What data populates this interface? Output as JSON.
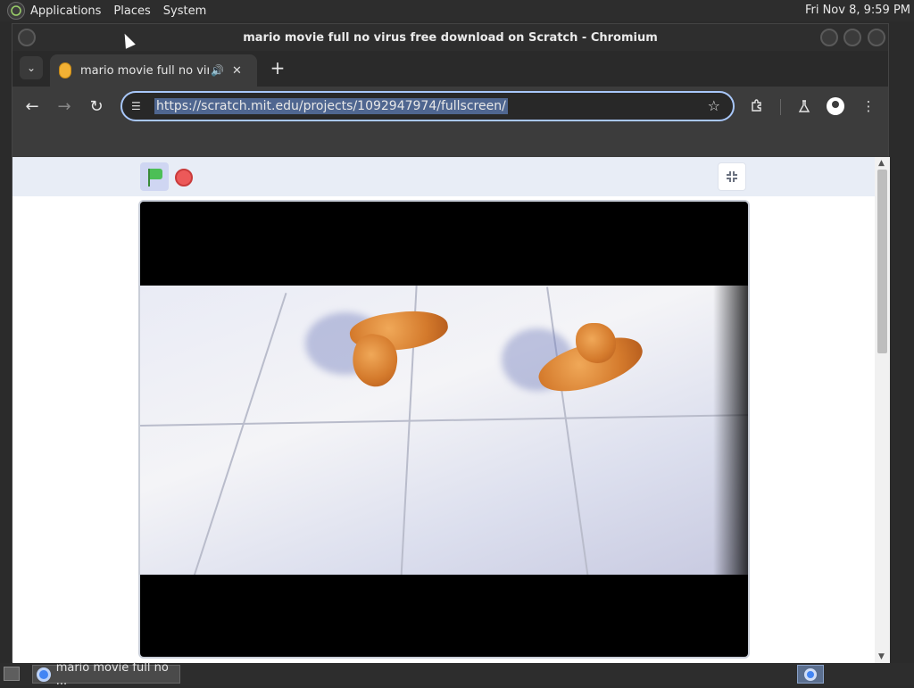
{
  "top_panel": {
    "menus": [
      "Applications",
      "Places",
      "System"
    ],
    "clock": "Fri Nov  8,  9:59 PM"
  },
  "window": {
    "title": "mario movie full no virus free download on Scratch - Chromium"
  },
  "tabs": [
    {
      "title": "mario movie full no virus free download on Scratch",
      "audio": "speaker-icon",
      "active": true
    }
  ],
  "toolbar": {
    "url": "https://scratch.mit.edu/projects/1092947974/fullscreen/"
  },
  "icons": {
    "tab_list": "chevron-down-icon",
    "new_tab": "plus-icon",
    "back": "arrow-left-icon",
    "forward": "arrow-right-icon",
    "reload": "reload-icon",
    "site_info": "tune-icon",
    "bookmark": "star-icon",
    "extensions": "puzzle-icon",
    "labs": "flask-icon",
    "profile": "avatar-icon",
    "menu": "kebab-menu-icon"
  },
  "scratch": {
    "green_flag": "green-flag-icon",
    "stop": "stop-icon",
    "unfullscreen": "unfullscreen-icon"
  },
  "taskbar": {
    "task_label": "mario movie full no ..."
  },
  "colors": {
    "omnibox_focus": "#a8c7fa",
    "flag_green": "#4cbf56",
    "stop_red": "#ec5959"
  }
}
